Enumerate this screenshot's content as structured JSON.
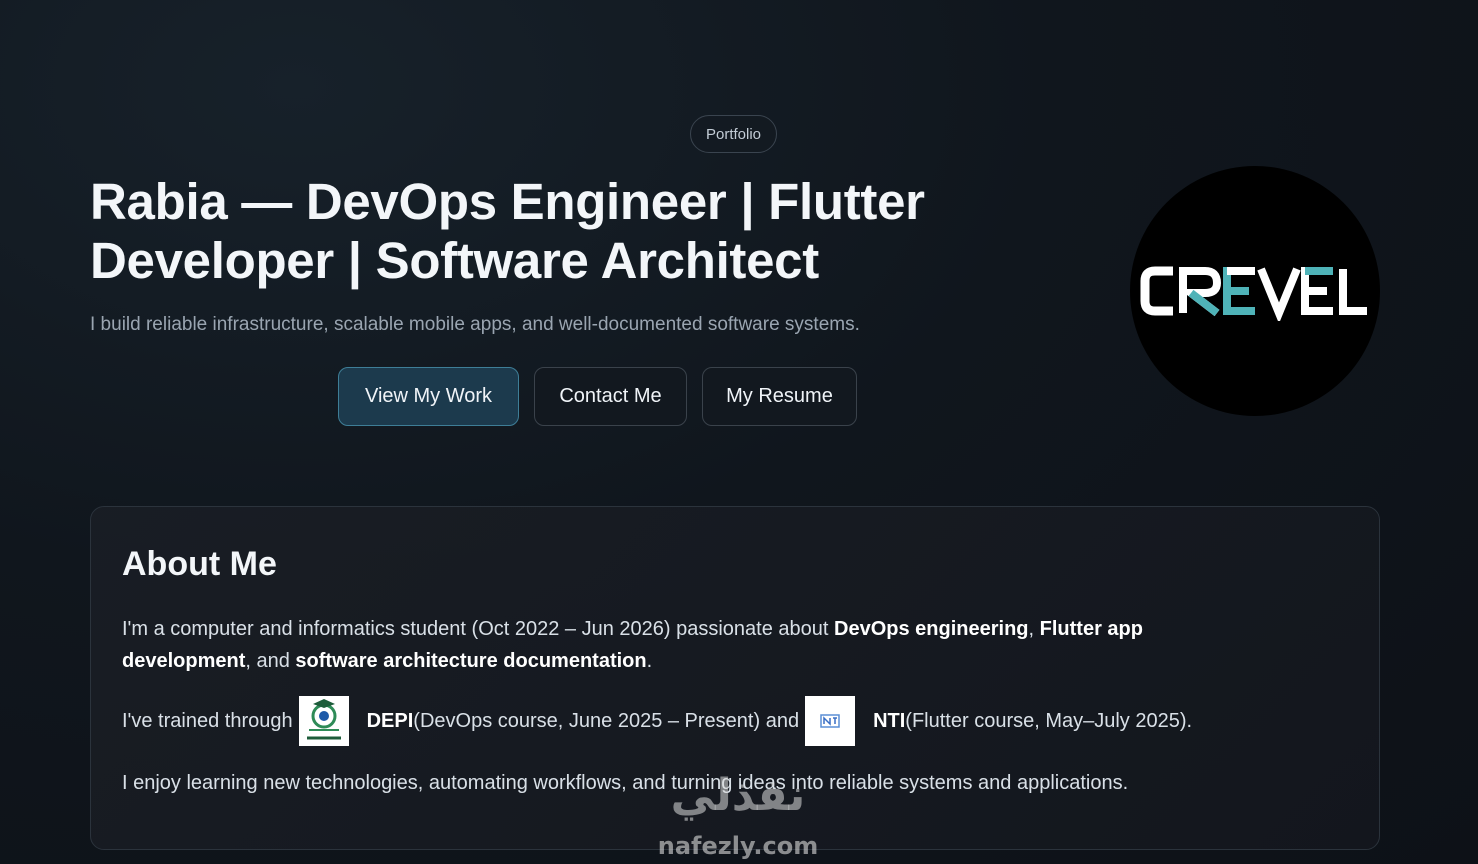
{
  "hero": {
    "badge": "Portfolio",
    "title": "Rabia — DevOps Engineer | Flutter Developer | Software Architect",
    "subtitle": "I build reliable infrastructure, scalable mobile apps, and well-documented software systems.",
    "buttons": {
      "view_work": "View My Work",
      "contact": "Contact Me",
      "resume": "My Resume"
    },
    "logo_text": "CREVEL"
  },
  "about": {
    "title": "About Me",
    "p1": {
      "t1": "I'm a computer and informatics student (Oct 2022 – Jun 2026) passionate about ",
      "b1": "DevOps engineering",
      "t2": ", ",
      "b2": "Flutter app development",
      "t3": ", and ",
      "b3": "software architecture documentation",
      "t4": "."
    },
    "p2": {
      "t1": "I've trained through",
      "org1": "DEPI",
      "org1_detail": " (DevOps course, June 2025 – Present) and",
      "org2": "NTI",
      "org2_detail": " (Flutter course, May–July 2025)."
    },
    "p3": "I enjoy learning new technologies, automating workflows, and turning ideas into reliable systems and applications."
  },
  "watermark": {
    "arabic": "نفذلي",
    "latin": "nafezly.com"
  },
  "colors": {
    "accent": "#3e7e97",
    "logo_teal": "#4fb3b8",
    "background": "#10161d"
  }
}
